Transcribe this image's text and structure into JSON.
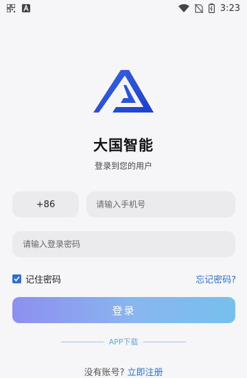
{
  "status_bar": {
    "time": "3:23",
    "icons": [
      "qr-scan-icon",
      "a-badge-icon",
      "wifi-icon",
      "no-sim-icon",
      "battery-icon"
    ]
  },
  "app": {
    "name": "大国智能",
    "subtitle": "登录到您的用户"
  },
  "form": {
    "country_code": "+86",
    "phone_placeholder": "请输入手机号",
    "password_placeholder": "请输入登录密码",
    "remember_label": "记住密码",
    "remember_checked": true,
    "forgot_label": "忘记密码?",
    "login_label": "登录"
  },
  "footer": {
    "app_download": "APP下载",
    "no_account": "没有账号?",
    "register": "立即注册"
  },
  "colors": {
    "accent": "#2f6fd6",
    "background": "#f6f6f8",
    "field": "#ebebed"
  }
}
